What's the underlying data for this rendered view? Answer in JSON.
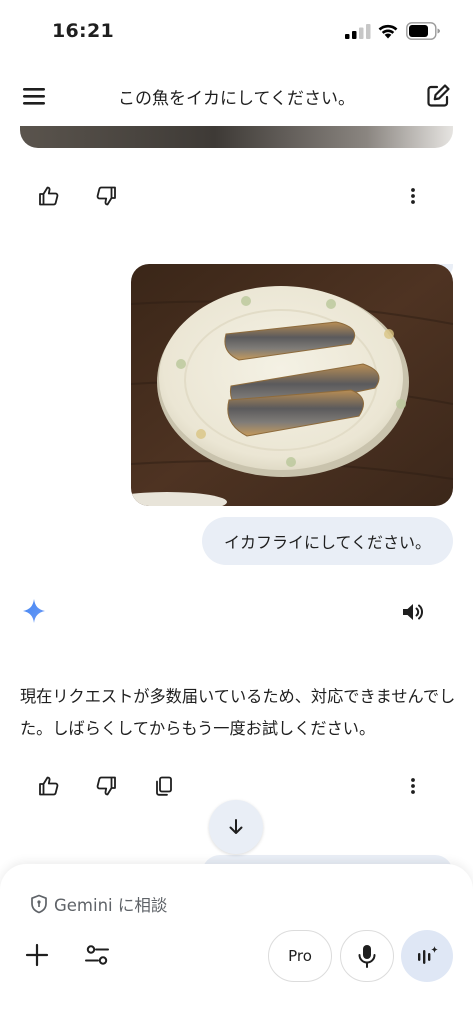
{
  "status_bar": {
    "time": "16:21"
  },
  "header": {
    "title": "この魚をイカにしてください。"
  },
  "conversation": {
    "user_message": "イカフライにしてください。",
    "gemini_reply": "現在リクエストが多数届いているため、対応できませんでした。しばらくしてからもう一度お試しください。"
  },
  "input": {
    "placeholder": "Gemini に相談",
    "model_label": "Pro"
  },
  "icons": {
    "menu": "menu-icon",
    "edit": "edit-icon",
    "thumbs_up": "thumbs-up-icon",
    "thumbs_down": "thumbs-down-icon",
    "more": "more-vert-icon",
    "copy": "copy-icon",
    "speaker": "speaker-icon",
    "gemini": "gemini-sparkle-icon",
    "scroll": "arrow-down-icon",
    "shield": "shield-icon",
    "plus": "plus-icon",
    "tools": "tools-icon",
    "mic": "mic-icon",
    "live": "live-waveform-icon"
  },
  "colors": {
    "accent": "#4285f4",
    "bubble": "#e9eef6",
    "live_bg": "#dfe7f5"
  }
}
